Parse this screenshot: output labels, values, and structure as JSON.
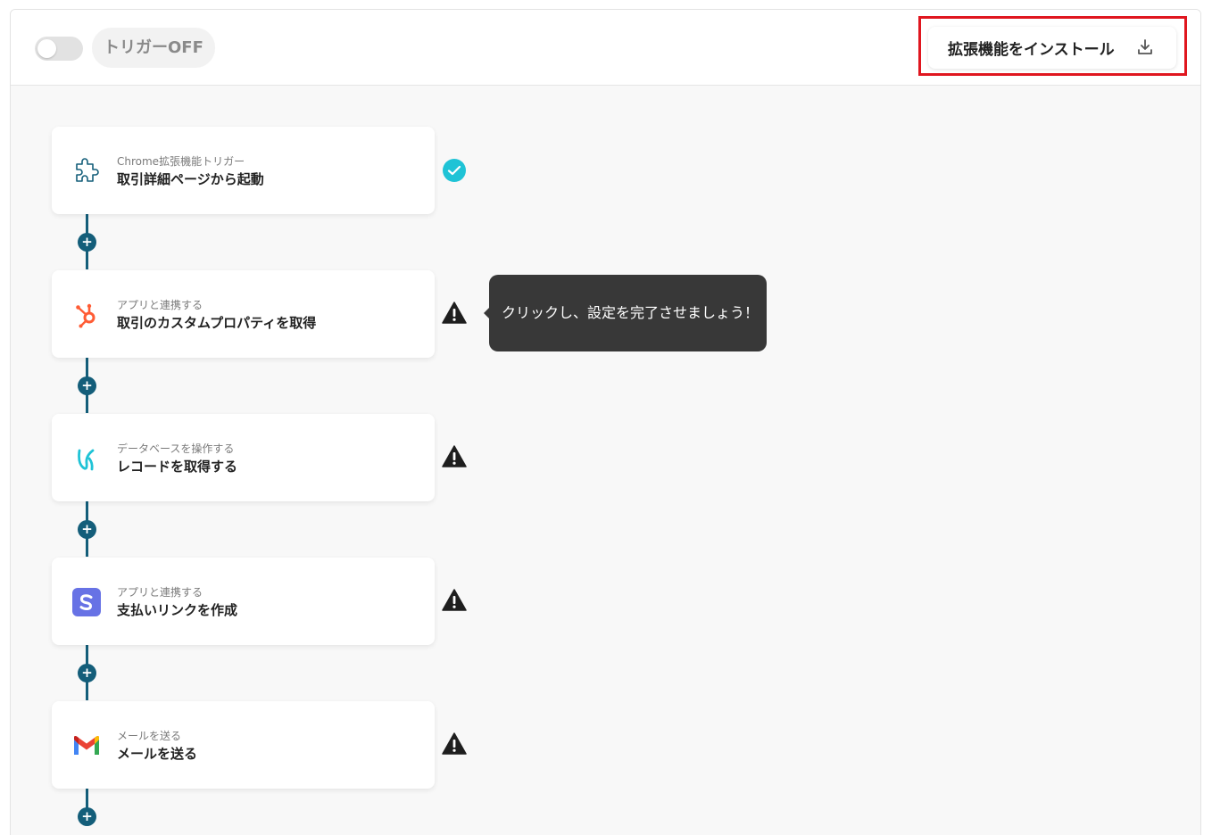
{
  "header": {
    "trigger_label": "トリガーOFF",
    "install_button_label": "拡張機能をインストール"
  },
  "steps": [
    {
      "subtitle": "Chrome拡張機能トリガー",
      "title": "取引詳細ページから起動",
      "icon": "puzzle-icon",
      "status": "complete"
    },
    {
      "subtitle": "アプリと連携する",
      "title": "取引のカスタムプロパティを取得",
      "icon": "hubspot-icon",
      "status": "warning"
    },
    {
      "subtitle": "データベースを操作する",
      "title": "レコードを取得する",
      "icon": "database-app-icon",
      "status": "warning"
    },
    {
      "subtitle": "アプリと連携する",
      "title": "支払いリンクを作成",
      "icon": "stripe-icon",
      "status": "warning"
    },
    {
      "subtitle": "メールを送る",
      "title": "メールを送る",
      "icon": "gmail-icon",
      "status": "warning"
    }
  ],
  "tooltip": {
    "text": "クリックし、設定を完了させましょう！"
  },
  "colors": {
    "connector": "#145e7a",
    "complete": "#1fc3d6",
    "highlight": "#e0161f",
    "hubspot": "#ff5c35",
    "stripe": "#6772e5",
    "tooltip_bg": "#383838"
  }
}
